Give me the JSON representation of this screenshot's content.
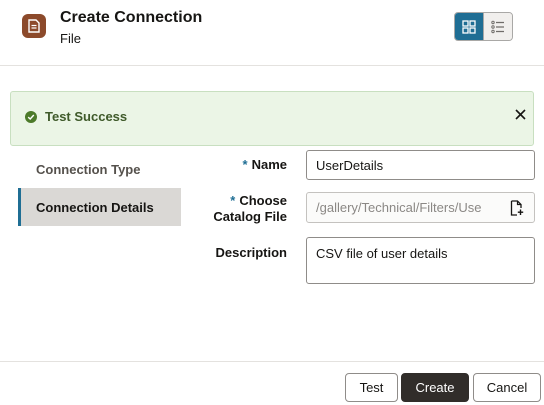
{
  "header": {
    "title": "Create Connection",
    "subtitle": "File",
    "icon": "file-document-icon",
    "accent_color": "#8c4a2b",
    "view_toggle": {
      "active": "grid-view",
      "options": [
        "grid-view-icon",
        "list-view-icon"
      ]
    }
  },
  "banner": {
    "message": "Test Success",
    "status_color": "#4c7a2a"
  },
  "steps": [
    {
      "label": "Connection Type",
      "selected": false
    },
    {
      "label": "Connection Details",
      "selected": true
    }
  ],
  "form": {
    "name": {
      "required_marker": "*",
      "label": "Name",
      "value": "UserDetails"
    },
    "catalog_file": {
      "required_marker": "*",
      "label_line1": "Choose",
      "label_line2": "Catalog File",
      "value": "/gallery/Technical/Filters/Use"
    },
    "description": {
      "label": "Description",
      "value": "CSV file of user details"
    }
  },
  "footer": {
    "test_label": "Test",
    "create_label": "Create",
    "cancel_label": "Cancel"
  }
}
